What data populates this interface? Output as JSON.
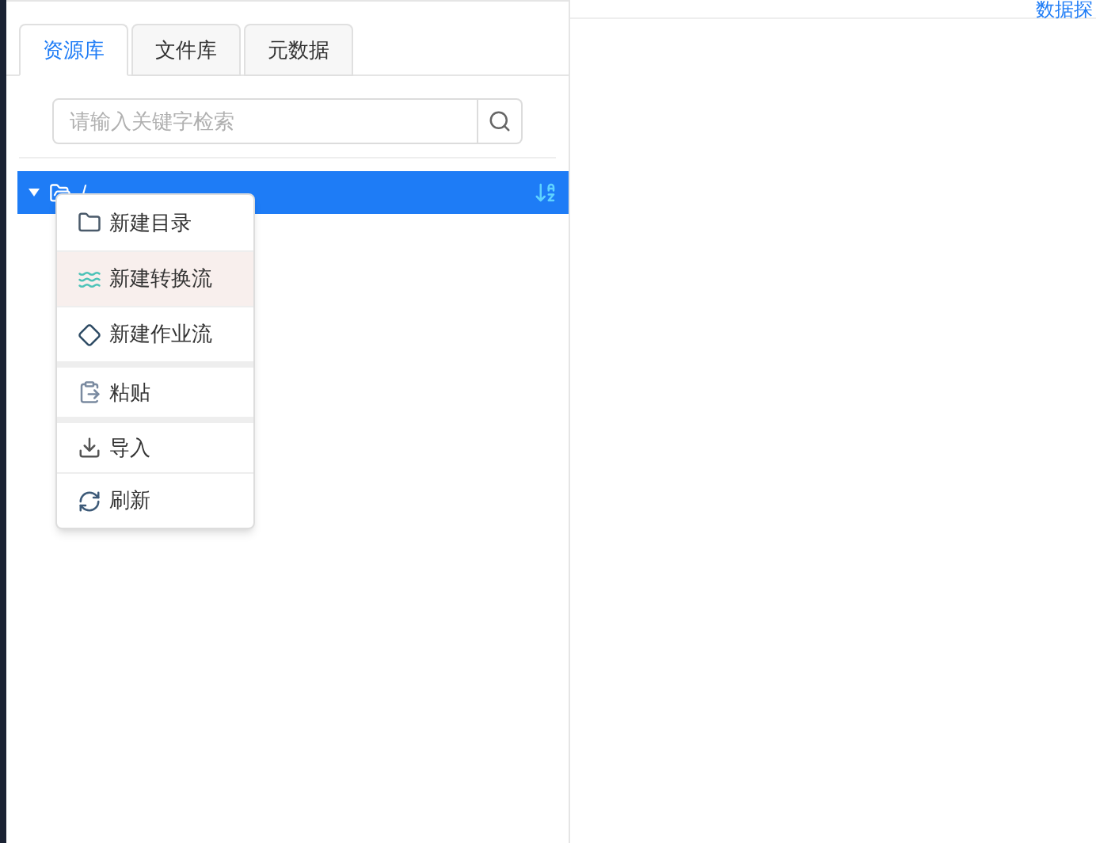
{
  "header_link": "数据探",
  "tabs": [
    {
      "label": "资源库",
      "selected": true
    },
    {
      "label": "文件库",
      "selected": false
    },
    {
      "label": "元数据",
      "selected": false
    }
  ],
  "search": {
    "placeholder": "请输入关键字检索"
  },
  "tree": [
    {
      "label": "/",
      "expanded": true,
      "selected": true
    }
  ],
  "context_menu": [
    {
      "kind": "folder",
      "label": "新建目录",
      "highlighted": false,
      "group_start": false
    },
    {
      "kind": "waves",
      "label": "新建转换流",
      "highlighted": true,
      "group_start": false
    },
    {
      "kind": "diamond",
      "label": "新建作业流",
      "highlighted": false,
      "group_start": false
    },
    {
      "kind": "paste",
      "label": "粘贴",
      "highlighted": false,
      "group_start": true
    },
    {
      "kind": "import",
      "label": "导入",
      "highlighted": false,
      "group_start": true
    },
    {
      "kind": "refresh",
      "label": "刷新",
      "highlighted": false,
      "group_start": false
    }
  ]
}
